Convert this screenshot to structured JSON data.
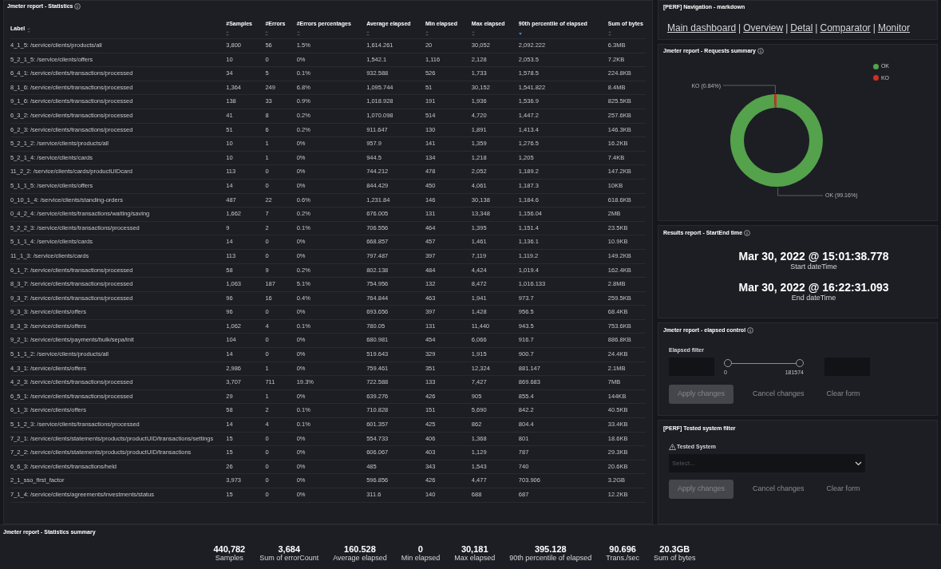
{
  "statistics": {
    "title": "Jmeter report - Statistics",
    "columns": [
      {
        "label": "Label",
        "sorted": false
      },
      {
        "label": "#Samples",
        "sorted": false
      },
      {
        "label": "#Errors",
        "sorted": false
      },
      {
        "label": "#Errors percentages",
        "sorted": false
      },
      {
        "label": "Average elapsed",
        "sorted": false
      },
      {
        "label": "Min elapsed",
        "sorted": false
      },
      {
        "label": "Max elapsed",
        "sorted": false
      },
      {
        "label": "90th percentile of elapsed",
        "sorted": true
      },
      {
        "label": "Sum of bytes",
        "sorted": false
      }
    ],
    "rows": [
      [
        "4_1_5: /service/clients/products/all",
        "3,800",
        "56",
        "1.5%",
        "1,614.261",
        "20",
        "30,052",
        "2,092.222",
        "6.3MB"
      ],
      [
        "5_2_1_5: /service/clients/offers",
        "10",
        "0",
        "0%",
        "1,542.1",
        "1,116",
        "2,128",
        "2,053.5",
        "7.2KB"
      ],
      [
        "6_4_1: /service/clients/transactions/processed",
        "34",
        "5",
        "0.1%",
        "932.588",
        "526",
        "1,733",
        "1,578.5",
        "224.8KB"
      ],
      [
        "8_1_6: /service/clients/transactions/processed",
        "1,364",
        "249",
        "6.8%",
        "1,095.744",
        "51",
        "30,152",
        "1,541.822",
        "8.4MB"
      ],
      [
        "9_1_6: /service/clients/transactions/processed",
        "138",
        "33",
        "0.9%",
        "1,018.928",
        "191",
        "1,936",
        "1,536.9",
        "825.5KB"
      ],
      [
        "6_3_2: /service/clients/transactions/processed",
        "41",
        "8",
        "0.2%",
        "1,070.098",
        "514",
        "4,720",
        "1,447.2",
        "257.6KB"
      ],
      [
        "6_2_3: /service/clients/transactions/processed",
        "51",
        "6",
        "0.2%",
        "911.647",
        "130",
        "1,891",
        "1,413.4",
        "146.3KB"
      ],
      [
        "5_2_1_2: /service/clients/products/all",
        "10",
        "1",
        "0%",
        "957.9",
        "141",
        "1,359",
        "1,276.5",
        "16.2KB"
      ],
      [
        "5_2_1_4: /service/clients/cards",
        "10",
        "1",
        "0%",
        "944.5",
        "134",
        "1,218",
        "1,205",
        "7.4KB"
      ],
      [
        "11_2_2: /service/clients/cards/productUIDcard",
        "113",
        "0",
        "0%",
        "744.212",
        "478",
        "2,052",
        "1,189.2",
        "147.2KB"
      ],
      [
        "5_1_1_5: /service/clients/offers",
        "14",
        "0",
        "0%",
        "844.429",
        "450",
        "4,061",
        "1,187.3",
        "10KB"
      ],
      [
        "0_10_1_4: /service/clients/standing-orders",
        "487",
        "22",
        "0.6%",
        "1,231.84",
        "146",
        "30,138",
        "1,184.6",
        "618.6KB"
      ],
      [
        "0_4_2_4: /service/clients/transactions/waiting/saving",
        "1,662",
        "7",
        "0.2%",
        "676.005",
        "131",
        "13,348",
        "1,156.04",
        "2MB"
      ],
      [
        "5_2_2_3: /service/clients/transactions/processed",
        "9",
        "2",
        "0.1%",
        "706.556",
        "464",
        "1,395",
        "1,151.4",
        "23.5KB"
      ],
      [
        "5_1_1_4: /service/clients/cards",
        "14",
        "0",
        "0%",
        "668.857",
        "457",
        "1,461",
        "1,136.1",
        "10.9KB"
      ],
      [
        "11_1_3: /service/clients/cards",
        "113",
        "0",
        "0%",
        "797.487",
        "397",
        "7,119",
        "1,119.2",
        "149.2KB"
      ],
      [
        "6_1_7: /service/clients/transactions/processed",
        "58",
        "9",
        "0.2%",
        "802.138",
        "484",
        "4,424",
        "1,019.4",
        "162.4KB"
      ],
      [
        "8_3_7: /service/clients/transactions/processed",
        "1,063",
        "187",
        "5.1%",
        "754.956",
        "132",
        "8,472",
        "1,016.133",
        "2.8MB"
      ],
      [
        "9_3_7: /service/clients/transactions/processed",
        "96",
        "16",
        "0.4%",
        "764.844",
        "463",
        "1,941",
        "973.7",
        "259.5KB"
      ],
      [
        "9_3_3: /service/clients/offers",
        "96",
        "0",
        "0%",
        "693.656",
        "397",
        "1,428",
        "956.5",
        "68.4KB"
      ],
      [
        "8_3_3: /service/clients/offers",
        "1,062",
        "4",
        "0.1%",
        "780.05",
        "131",
        "11,440",
        "943.5",
        "753.6KB"
      ],
      [
        "9_2_1: /service/clients/payments/bulk/sepa/init",
        "104",
        "0",
        "0%",
        "680.981",
        "454",
        "6,066",
        "916.7",
        "886.8KB"
      ],
      [
        "5_1_1_2: /service/clients/products/all",
        "14",
        "0",
        "0%",
        "519.643",
        "329",
        "1,915",
        "900.7",
        "24.4KB"
      ],
      [
        "4_3_1: /service/clients/offers",
        "2,986",
        "1",
        "0%",
        "759.461",
        "351",
        "12,324",
        "881.147",
        "2.1MB"
      ],
      [
        "4_2_3: /service/clients/transactions/processed",
        "3,707",
        "711",
        "19.3%",
        "722.588",
        "133",
        "7,427",
        "869.683",
        "7MB"
      ],
      [
        "6_5_1: /service/clients/transactions/processed",
        "29",
        "1",
        "0%",
        "639.276",
        "426",
        "905",
        "855.4",
        "144KB"
      ],
      [
        "6_1_3: /service/clients/offers",
        "58",
        "2",
        "0.1%",
        "710.828",
        "151",
        "5,690",
        "842.2",
        "40.5KB"
      ],
      [
        "5_1_2_3: /service/clients/transactions/processed",
        "14",
        "4",
        "0.1%",
        "601.357",
        "425",
        "862",
        "804.4",
        "33.4KB"
      ],
      [
        "7_2_1: /service/clients/statements/products/productUID/transactions/settings",
        "15",
        "0",
        "0%",
        "554.733",
        "406",
        "1,368",
        "801",
        "18.6KB"
      ],
      [
        "7_2_2: /service/clients/statements/products/productUID/transactions",
        "15",
        "0",
        "0%",
        "606.067",
        "403",
        "1,129",
        "787",
        "29.3KB"
      ],
      [
        "6_6_3: /service/clients/transactions/held",
        "26",
        "0",
        "0%",
        "485",
        "343",
        "1,543",
        "740",
        "20.6KB"
      ],
      [
        "2_1_sso_first_factor",
        "3,973",
        "0",
        "0%",
        "596.856",
        "426",
        "4,477",
        "703.906",
        "3.2GB"
      ],
      [
        "7_1_4: /service/clients/agreements/investments/status",
        "15",
        "0",
        "0%",
        "311.6",
        "140",
        "688",
        "687",
        "12.2KB"
      ]
    ]
  },
  "navigation": {
    "title": "[PERF] Navigation - markdown",
    "links": [
      "Main dashboard",
      "Overview",
      "Detal",
      "Comparator",
      "Monitor"
    ],
    "separator": "|"
  },
  "requests_summary": {
    "title": "Jmeter report - Requests summary",
    "legend": [
      {
        "color": "#54a24b"
      },
      {
        "color": "#d0301f"
      }
    ],
    "chart_data": {
      "type": "donut",
      "categories": [
        "OK",
        "KO"
      ],
      "series": [
        {
          "values": [
            99.16,
            0.84
          ]
        }
      ],
      "value_labels": [
        "OK (99.16%)",
        "KO (0.84%)"
      ]
    }
  },
  "start_end": {
    "title": "Results report - StartEnd time",
    "items": [
      {
        "value": "Mar 30, 2022 @ 15:01:38.778",
        "label": "Start dateTime"
      },
      {
        "value": "Mar 30, 2022 @ 16:22:31.093",
        "label": "End dateTime"
      }
    ]
  },
  "elapsed_control": {
    "title": "Jmeter report - elapsed control",
    "filter_label": "Elapsed filter",
    "min_label": "0",
    "max_label": "181574",
    "thumbs": [
      {
        "level": 0
      },
      {
        "level": 1
      }
    ],
    "buttons": [
      {
        "label": "Apply changes",
        "kind": "filled",
        "disabled": true
      },
      {
        "label": "Cancel changes",
        "kind": "empty",
        "disabled": false
      },
      {
        "label": "Clear form",
        "kind": "empty",
        "disabled": false
      }
    ]
  },
  "tested_system": {
    "title": "[PERF] Tested system filter",
    "field_label": "Tested System",
    "warning": true,
    "placeholder": "Select...",
    "buttons": [
      {
        "label": "Apply changes",
        "kind": "filled",
        "disabled": true
      },
      {
        "label": "Cancel changes",
        "kind": "empty",
        "disabled": false
      },
      {
        "label": "Clear form",
        "kind": "empty",
        "disabled": false
      }
    ]
  },
  "summary": {
    "title": "Jmeter report - Statistics summary",
    "stats": [
      {
        "value": "440,782",
        "label": "Samples"
      },
      {
        "value": "3,684",
        "label": "Sum of errorCount"
      },
      {
        "value": "160.528",
        "label": "Average elapsed"
      },
      {
        "value": "0",
        "label": "Min elapsed"
      },
      {
        "value": "30,181",
        "label": "Max elapsed"
      },
      {
        "value": "395.128",
        "label": "90th percentile of elapsed"
      },
      {
        "value": "90.696",
        "label": "Trans./sec"
      },
      {
        "value": "20.3GB",
        "label": "Sum of bytes"
      }
    ]
  }
}
